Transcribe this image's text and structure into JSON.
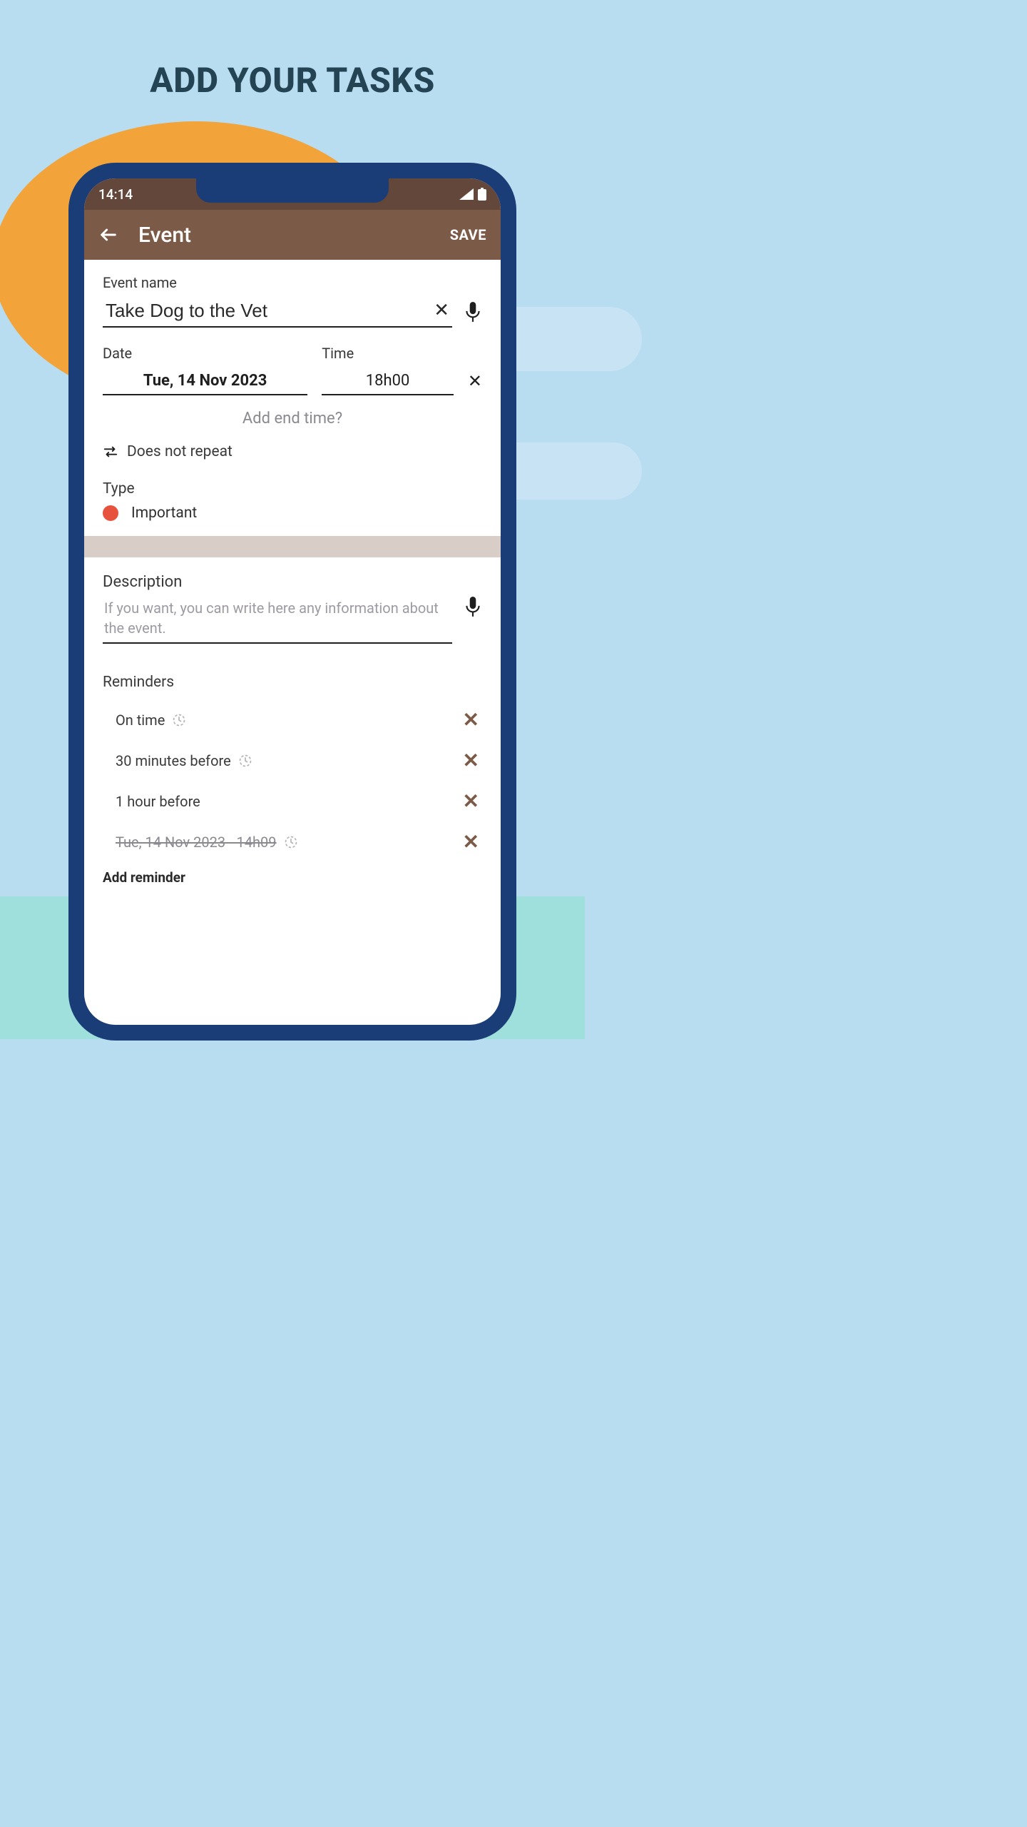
{
  "marketing": {
    "headline": "ADD YOUR TASKS"
  },
  "status": {
    "time": "14:14"
  },
  "appbar": {
    "title": "Event",
    "save": "SAVE"
  },
  "event": {
    "name_label": "Event name",
    "name": "Take Dog to the Vet",
    "date_label": "Date",
    "date": "Tue, 14 Nov 2023",
    "time_label": "Time",
    "time": "18h00",
    "add_end_time": "Add end time?",
    "repeat": "Does not repeat",
    "type_label": "Type",
    "type_value": "Important",
    "type_color": "#e7523c"
  },
  "description": {
    "label": "Description",
    "placeholder": "If you want, you can write here any information about the event."
  },
  "reminders": {
    "label": "Reminders",
    "add": "Add reminder",
    "items": [
      {
        "text": "On time",
        "clock": true,
        "strike": false
      },
      {
        "text": "30 minutes before",
        "clock": true,
        "strike": false
      },
      {
        "text": "1 hour before",
        "clock": false,
        "strike": false
      },
      {
        "text": "Tue, 14 Nov 2023 - 14h09",
        "clock": true,
        "strike": true
      }
    ]
  }
}
